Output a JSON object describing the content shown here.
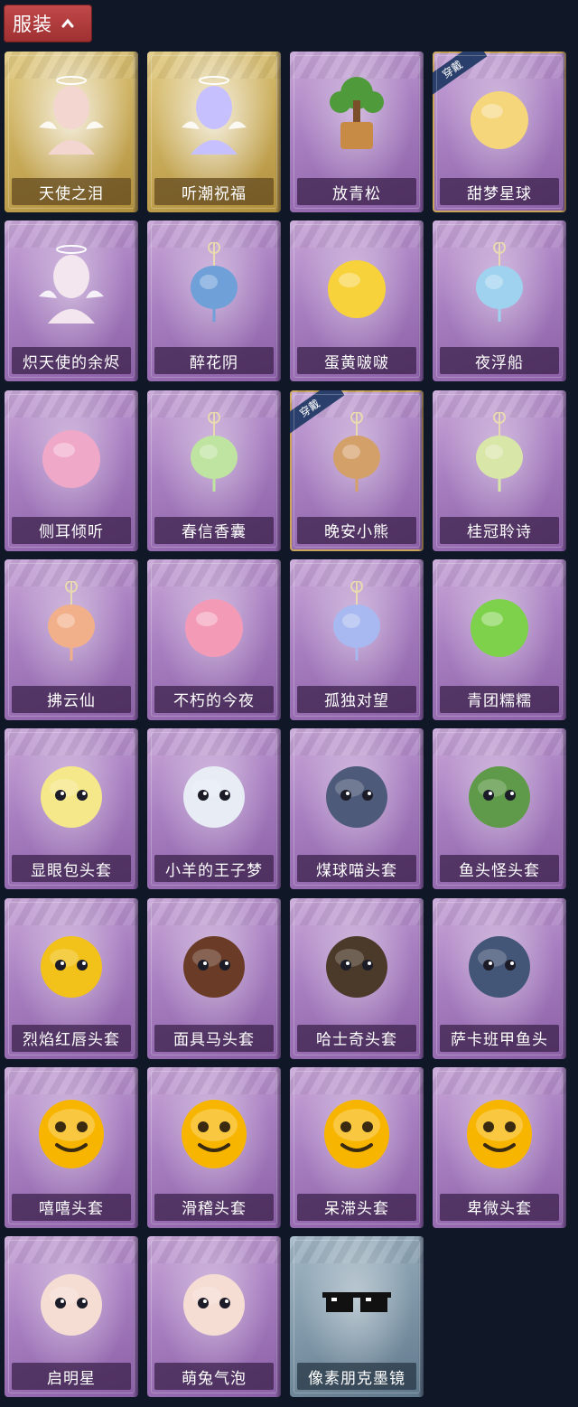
{
  "header": {
    "label": "服装",
    "icon": "chevron-up-icon"
  },
  "equipped_label": "穿戴",
  "items": [
    {
      "name": "天使之泪",
      "rarity": "gold",
      "icon": "angel-tears-icon",
      "color": "#f2d6cf",
      "equipped": false
    },
    {
      "name": "听潮祝福",
      "rarity": "gold",
      "icon": "wave-blessing-icon",
      "color": "#c7c0ff",
      "equipped": false
    },
    {
      "name": "放青松",
      "rarity": "purple",
      "icon": "pine-tree-icon",
      "color": "#4f9a3a",
      "equipped": false
    },
    {
      "name": "甜梦星球",
      "rarity": "purple",
      "icon": "moon-fox-icon",
      "color": "#f5d67a",
      "equipped": true
    },
    {
      "name": "炽天使的余烬",
      "rarity": "purple",
      "icon": "seraph-doll-icon",
      "color": "#f3e6ef",
      "equipped": false
    },
    {
      "name": "醉花阴",
      "rarity": "purple",
      "icon": "flower-ornament-icon",
      "color": "#6fa0d8",
      "equipped": false
    },
    {
      "name": "蛋黄啵啵",
      "rarity": "purple",
      "icon": "chick-egg-icon",
      "color": "#f7d23a",
      "equipped": false
    },
    {
      "name": "夜浮船",
      "rarity": "purple",
      "icon": "jellyfish-icon",
      "color": "#9fd2ee",
      "equipped": false
    },
    {
      "name": "侧耳倾听",
      "rarity": "purple",
      "icon": "flower-wreath-icon",
      "color": "#f0a8c8",
      "equipped": false
    },
    {
      "name": "春信香囊",
      "rarity": "purple",
      "icon": "sachet-icon",
      "color": "#bfe3a0",
      "equipped": false
    },
    {
      "name": "晚安小熊",
      "rarity": "purple",
      "icon": "bear-charm-icon",
      "color": "#d4a06a",
      "equipped": true
    },
    {
      "name": "桂冠聆诗",
      "rarity": "purple",
      "icon": "fairy-charm-icon",
      "color": "#d8e6a8",
      "equipped": false
    },
    {
      "name": "拂云仙",
      "rarity": "purple",
      "icon": "immortal-charm-icon",
      "color": "#f2b08a",
      "equipped": false
    },
    {
      "name": "不朽的今夜",
      "rarity": "purple",
      "icon": "pink-fox-icon",
      "color": "#f39ab7",
      "equipped": false
    },
    {
      "name": "孤独对望",
      "rarity": "purple",
      "icon": "doll-charm-icon",
      "color": "#a8b8f0",
      "equipped": false
    },
    {
      "name": "青团糯糯",
      "rarity": "purple",
      "icon": "green-dumpling-icon",
      "color": "#7ed14a",
      "equipped": false
    },
    {
      "name": "显眼包头套",
      "rarity": "purple",
      "icon": "bulb-head-icon",
      "color": "#f5e88a",
      "equipped": false
    },
    {
      "name": "小羊的王子梦",
      "rarity": "purple",
      "icon": "sheep-head-icon",
      "color": "#e7ecf5",
      "equipped": false
    },
    {
      "name": "煤球喵头套",
      "rarity": "purple",
      "icon": "cat-head-icon",
      "color": "#4e5a7a",
      "equipped": false
    },
    {
      "name": "鱼头怪头套",
      "rarity": "purple",
      "icon": "fish-mask-icon",
      "color": "#5f9a4a",
      "equipped": false
    },
    {
      "name": "烈焰红唇头套",
      "rarity": "purple",
      "icon": "yellow-mask-icon",
      "color": "#f2c21a",
      "equipped": false
    },
    {
      "name": "面具马头套",
      "rarity": "purple",
      "icon": "horse-mask-icon",
      "color": "#6a3c28",
      "equipped": false
    },
    {
      "name": "哈士奇头套",
      "rarity": "purple",
      "icon": "husky-mask-icon",
      "color": "#4b3a2a",
      "equipped": false
    },
    {
      "name": "萨卡班甲鱼头",
      "rarity": "purple",
      "icon": "fish-head-icon",
      "color": "#445677",
      "equipped": false
    },
    {
      "name": "嘻嘻头套",
      "rarity": "purple",
      "icon": "grin-emoji-icon",
      "color": "#f7b500",
      "equipped": false
    },
    {
      "name": "滑稽头套",
      "rarity": "purple",
      "icon": "smirk-emoji-icon",
      "color": "#f7b500",
      "equipped": false
    },
    {
      "name": "呆滞头套",
      "rarity": "purple",
      "icon": "dazed-emoji-icon",
      "color": "#f7b500",
      "equipped": false
    },
    {
      "name": "卑微头套",
      "rarity": "purple",
      "icon": "humble-emoji-icon",
      "color": "#f7b500",
      "equipped": false
    },
    {
      "name": "启明星",
      "rarity": "purple",
      "icon": "halo-head-icon",
      "color": "#f5ddd4",
      "equipped": false
    },
    {
      "name": "萌兔气泡",
      "rarity": "purple",
      "icon": "bubble-head-icon",
      "color": "#f5ddd4",
      "equipped": false
    },
    {
      "name": "像素朋克墨镜",
      "rarity": "blue",
      "icon": "pixel-sunglasses-icon",
      "color": "#111111",
      "equipped": false
    }
  ]
}
